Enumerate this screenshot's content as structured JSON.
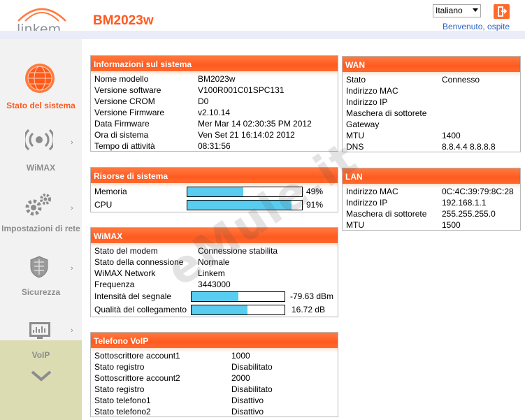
{
  "header": {
    "logo_text": "linkem",
    "device_name": "BM2023w",
    "language": "Italiano",
    "welcome": "Benvenuto, ospite"
  },
  "sidebar": {
    "items": [
      {
        "label": "Stato del sistema",
        "icon": "globe-icon",
        "active": true
      },
      {
        "label": "WiMAX",
        "icon": "wimax-signal-icon"
      },
      {
        "label": "Impostazioni di rete",
        "icon": "gears-icon"
      },
      {
        "label": "Sicurezza",
        "icon": "shield-icon"
      },
      {
        "label": "VoIP",
        "icon": "voip-monitor-icon"
      }
    ],
    "more_icon": "chevron-down-icon"
  },
  "system_info": {
    "title": "Informazioni sul sistema",
    "rows": [
      {
        "k": "Nome modello",
        "v": "BM2023w"
      },
      {
        "k": "Versione software",
        "v": "V100R001C01SPC131"
      },
      {
        "k": "Versione CROM",
        "v": "D0"
      },
      {
        "k": "Versione Firmware",
        "v": "v2.10.14"
      },
      {
        "k": "Data Firmware",
        "v": "Mer Mar 14 02:30:35 PM 2012"
      },
      {
        "k": "Ora di sistema",
        "v": "Ven Set 21 16:14:02 2012"
      },
      {
        "k": "Tempo di attività",
        "v": "08:31:56"
      }
    ]
  },
  "resources": {
    "title": "Risorse di sistema",
    "rows": [
      {
        "k": "Memoria",
        "v": "49%",
        "level": 0.49
      },
      {
        "k": "CPU",
        "v": "91%",
        "level": 0.91
      }
    ]
  },
  "wimax": {
    "title": "WiMAX",
    "rows": [
      {
        "k": "Stato del modem",
        "v": "Connessione stabilita"
      },
      {
        "k": "Stato della connessione",
        "v": "Normale"
      },
      {
        "k": "WiMAX Network",
        "v": "Linkem"
      },
      {
        "k": "Frequenza",
        "v": "3443000"
      }
    ],
    "signal": {
      "k": "Intensità del segnale",
      "v": "-79.63 dBm",
      "level": 0.5
    },
    "quality": {
      "k": "Qualità del collegamento",
      "v": "16.72 dB",
      "level": 0.6
    }
  },
  "voip": {
    "title": "Telefono VoIP",
    "rows": [
      {
        "k": "Sottoscrittore account1",
        "v": "1000"
      },
      {
        "k": "Stato registro",
        "v": "Disabilitato"
      },
      {
        "k": "Sottoscrittore account2",
        "v": "2000"
      },
      {
        "k": "Stato registro",
        "v": "Disabilitato"
      },
      {
        "k": "Stato telefono1",
        "v": "Disattivo"
      },
      {
        "k": "Stato telefono2",
        "v": "Disattivo"
      }
    ]
  },
  "wan": {
    "title": "WAN",
    "rows": [
      {
        "k": "Stato",
        "v": "Connesso"
      },
      {
        "k": "Indirizzo MAC",
        "v": ""
      },
      {
        "k": "Indirizzo IP",
        "v": ""
      },
      {
        "k": "Maschera di sottorete",
        "v": ""
      },
      {
        "k": "Gateway",
        "v": ""
      },
      {
        "k": "MTU",
        "v": "1400"
      },
      {
        "k": "DNS",
        "v": "8.8.4.4 8.8.8.8"
      }
    ]
  },
  "lan": {
    "title": "LAN",
    "rows": [
      {
        "k": "Indirizzo MAC",
        "v": "0C:4C:39:79:8C:28"
      },
      {
        "k": "Indirizzo IP",
        "v": "192.168.1.1"
      },
      {
        "k": "Maschera di sottorete",
        "v": "255.255.255.0"
      },
      {
        "k": "MTU",
        "v": "1500"
      }
    ]
  },
  "watermark": "eMule.it",
  "colors": {
    "accent": "#ff5a1f",
    "bar_fill": "#59cdf0",
    "link": "#2a62c8"
  }
}
